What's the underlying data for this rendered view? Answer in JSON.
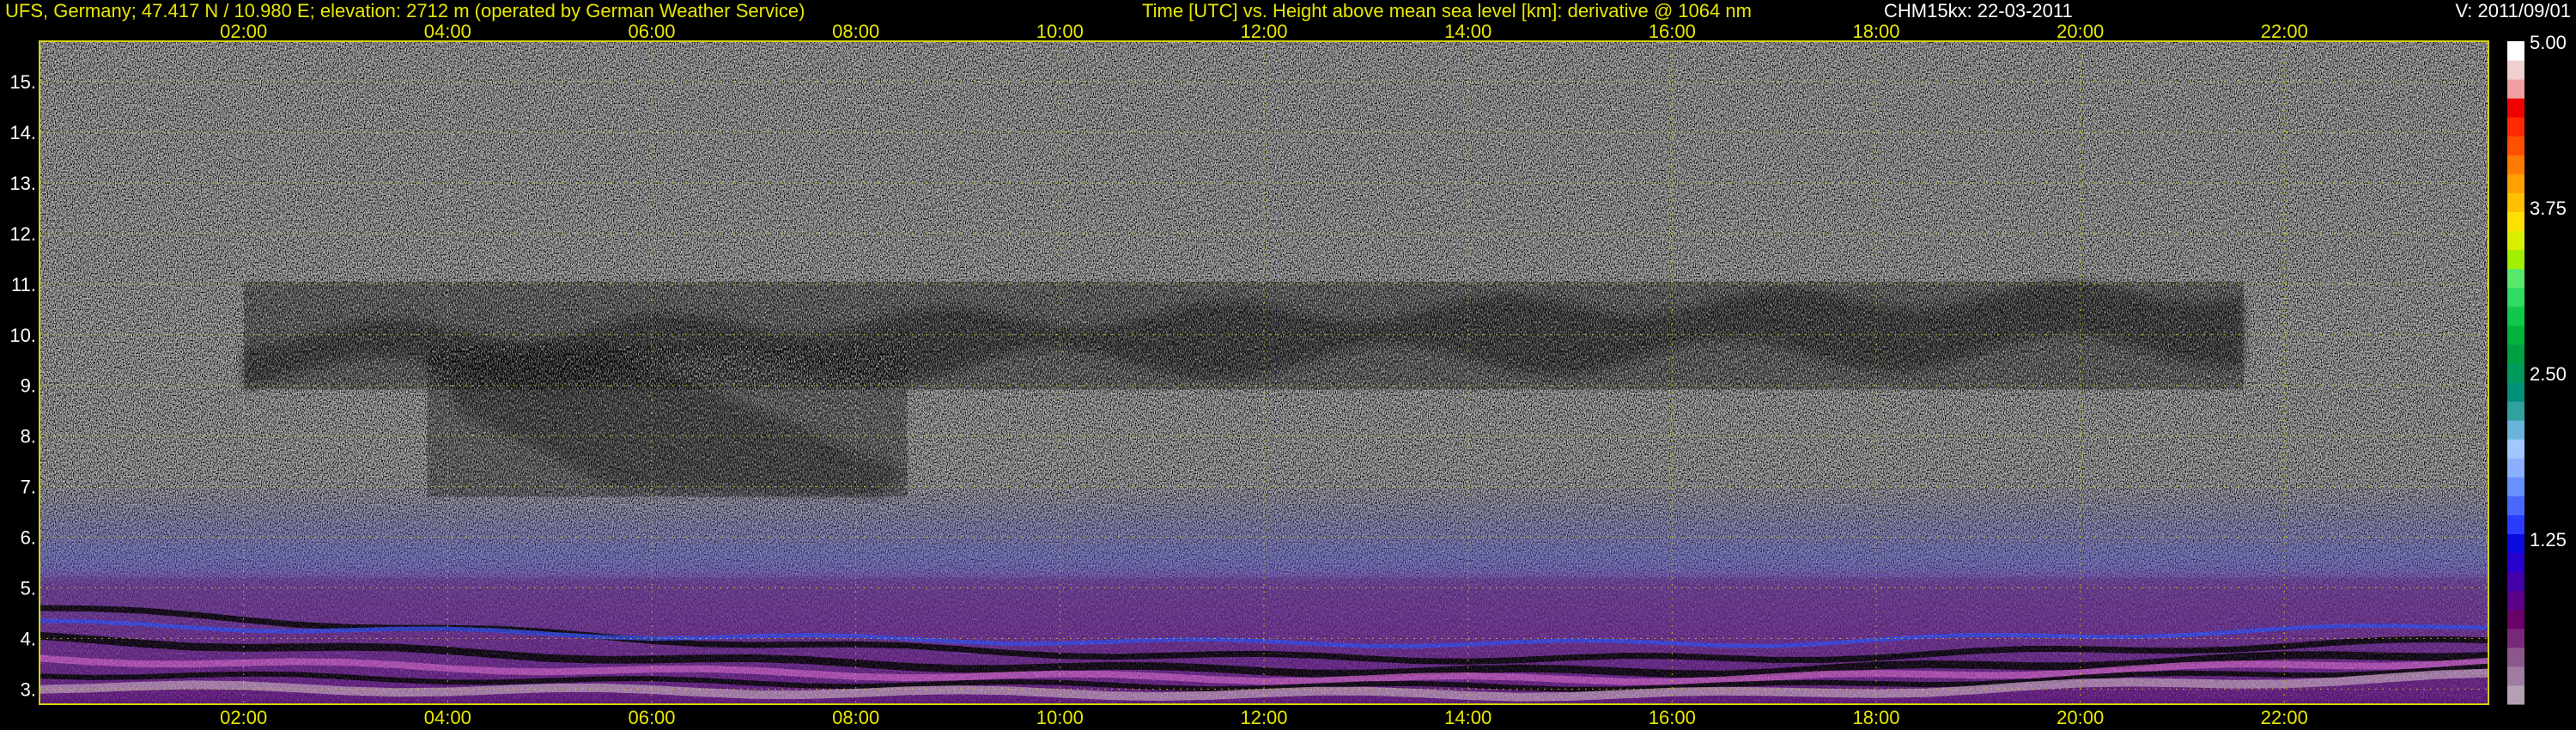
{
  "header": {
    "site": "UFS, Germany; 47.417 N / 10.980 E; elevation: 2712 m  (operated by German Weather Service)",
    "title": "Time [UTC] vs. Height above mean sea level [km]: derivative @ 1064 nm",
    "instrument": "CHM15kx: 22-03-2011",
    "version": "V: 2011/09/01"
  },
  "colors": {
    "background": "#000000",
    "axis_text_time": "#e8e800",
    "axis_text_height": "#ffffff",
    "grid": "#d4d400",
    "frame": "#d4d400"
  },
  "chart_data": {
    "type": "heatmap",
    "title": "Time [UTC] vs. Height above mean sea level [km]: derivative @ 1064 nm",
    "xlabel": "Time [UTC]",
    "ylabel": "Height above mean sea level [km]",
    "x_unit": "hours UTC",
    "xlim": [
      0,
      24
    ],
    "ylim": [
      2.7,
      15.8
    ],
    "x_ticks": [
      {
        "value": 2,
        "label": "02:00"
      },
      {
        "value": 4,
        "label": "04:00"
      },
      {
        "value": 6,
        "label": "06:00"
      },
      {
        "value": 8,
        "label": "08:00"
      },
      {
        "value": 10,
        "label": "10:00"
      },
      {
        "value": 12,
        "label": "12:00"
      },
      {
        "value": 14,
        "label": "14:00"
      },
      {
        "value": 16,
        "label": "16:00"
      },
      {
        "value": 18,
        "label": "18:00"
      },
      {
        "value": 20,
        "label": "20:00"
      },
      {
        "value": 22,
        "label": "22:00"
      }
    ],
    "y_ticks": [
      {
        "value": 3,
        "label": "3."
      },
      {
        "value": 4,
        "label": "4."
      },
      {
        "value": 5,
        "label": "5."
      },
      {
        "value": 6,
        "label": "6."
      },
      {
        "value": 7,
        "label": "7."
      },
      {
        "value": 8,
        "label": "8."
      },
      {
        "value": 9,
        "label": "9."
      },
      {
        "value": 10,
        "label": "10."
      },
      {
        "value": 11,
        "label": "11."
      },
      {
        "value": 12,
        "label": "12."
      },
      {
        "value": 13,
        "label": "13."
      },
      {
        "value": 14,
        "label": "14."
      },
      {
        "value": 15,
        "label": "15."
      }
    ],
    "grid": true,
    "colorbar": {
      "position": "right",
      "range": [
        0,
        5
      ],
      "tick_labels": [
        {
          "value": 1.25,
          "label": "1.25"
        },
        {
          "value": 2.5,
          "label": "2.50"
        },
        {
          "value": 3.75,
          "label": "3.75"
        },
        {
          "value": 5.0,
          "label": "5.00"
        }
      ],
      "colors": [
        "#b4a0b4",
        "#a07ca0",
        "#8c588c",
        "#782878",
        "#6a006a",
        "#5a008a",
        "#4400aa",
        "#2a00cc",
        "#0a0ae0",
        "#2a3cff",
        "#4a68ff",
        "#6a90ff",
        "#8cb0ff",
        "#a0c8ff",
        "#6ab4dc",
        "#30a0a0",
        "#00907a",
        "#009a5a",
        "#00a040",
        "#00b43c",
        "#10c84a",
        "#30dc60",
        "#58e86e",
        "#a0f000",
        "#d8f000",
        "#ffe000",
        "#ffc000",
        "#ffa000",
        "#ff7a00",
        "#ff5000",
        "#ff2a00",
        "#f00000",
        "#f0a0a0",
        "#f0d0d0",
        "#ffffff"
      ]
    },
    "features": [
      {
        "name": "cloud layer",
        "x_start": 2.0,
        "x_end": 21.8,
        "base_km": 9.0,
        "top_km": 11.7
      },
      {
        "name": "cloud fall streaks",
        "x_start": 3.8,
        "x_end": 8.5,
        "base_km": 6.8,
        "top_km": 9.5
      },
      {
        "name": "boundary layer",
        "x_start": 0.0,
        "x_end": 24.0,
        "base_km": 2.7,
        "top_km": 5.2
      },
      {
        "name": "aerosol haze",
        "x_start": 0.0,
        "x_end": 24.0,
        "base_km": 4.5,
        "top_km": 7.2
      }
    ]
  }
}
